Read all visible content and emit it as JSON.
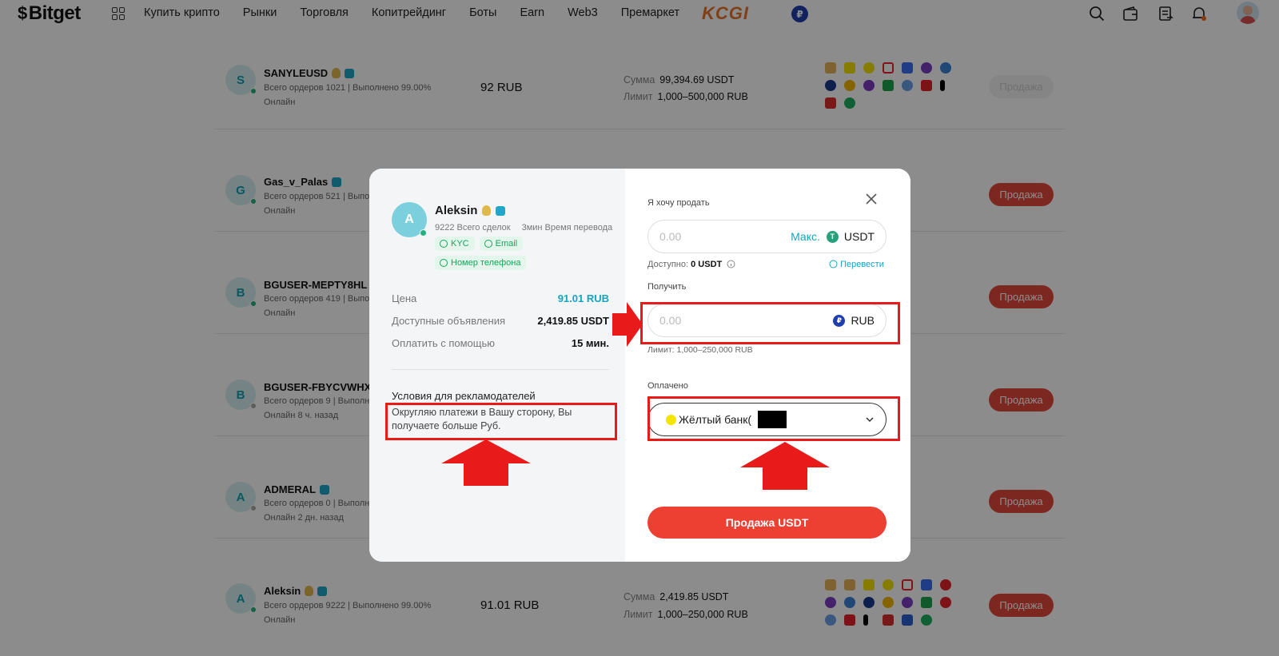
{
  "topbar": {
    "logo_text": "Bitget",
    "nav": [
      "Купить крипто",
      "Рынки",
      "Торговля",
      "Копитрейдинг",
      "Боты",
      "Earn",
      "Web3",
      "Премаркет"
    ],
    "promo_text": "KCGI",
    "currency_badge": "₽"
  },
  "list": {
    "rows": [
      {
        "initial": "S",
        "name": "SANYLEUSD",
        "sub": "Всего ордеров 1021 | Выполнено 99.00%",
        "status": "Онлайн",
        "price": "92 RUB",
        "amount_label": "Сумма",
        "amount": "99,394.69 USDT",
        "limit_label": "Лимит",
        "limit": "1,000–500,000 RUB",
        "button": "Продажа"
      },
      {
        "initial": "G",
        "name": "Gas_v_Palas",
        "sub": "Всего ордеров 521 | Выпол",
        "status": "Онлайн",
        "button": "Продажа"
      },
      {
        "initial": "B",
        "name": "BGUSER-MEPTY8HL",
        "sub": "Всего ордеров 419 | Выпол",
        "status": "Онлайн",
        "button": "Продажа"
      },
      {
        "initial": "B",
        "name": "BGUSER-FBYCVWHX",
        "sub": "Всего ордеров 9 | Выполне",
        "status": "Онлайн 8 ч. назад",
        "button": "Продажа"
      },
      {
        "initial": "A",
        "name": "ADMERAL",
        "sub": "Всего ордеров 0 | Выполнен",
        "status": "Онлайн 2 дн. назад",
        "button": "Продажа"
      },
      {
        "initial": "A",
        "name": "Aleksin",
        "sub": "Всего ордеров 9222 | Выполнено 99.00%",
        "status": "Онлайн",
        "price": "91.01 RUB",
        "amount_label": "Сумма",
        "amount": "2,419.85 USDT",
        "limit_label": "Лимит",
        "limit": "1,000–250,000 RUB",
        "button": "Продажа"
      }
    ]
  },
  "modal": {
    "merchant": {
      "initial": "A",
      "name": "Aleksin",
      "deals": "9222 Всего сделок",
      "transfer_time": "3мин Время перевода",
      "tags": [
        "KYC",
        "Email",
        "Номер телефона"
      ]
    },
    "price_label": "Цена",
    "price_value": "91.01 RUB",
    "available_label": "Доступные объявления",
    "available_value": "2,419.85 USDT",
    "pay_label": "Оплатить с помощью",
    "pay_value": "15 мин.",
    "terms_title": "Условия для рекламодателей",
    "terms_text": "Округляю платежи в Вашу сторону, Вы получаете больше Руб.",
    "sell_label": "Я хочу продать",
    "sell_placeholder": "0.00",
    "max_label": "Макс.",
    "sell_currency": "USDT",
    "available_text": "Доступно:",
    "available_amount": "0 USDT",
    "transfer_link": "Перевести",
    "receive_label": "Получить",
    "receive_placeholder": "0.00",
    "receive_currency": "RUB",
    "limit_text": "Лимит: 1,000–250,000 RUB",
    "paid_label": "Оплачено",
    "payment_method": "Жёлтый банк(",
    "payment_method_tail": ")",
    "submit_label": "Продажа USDT"
  },
  "colors": {
    "accent": "#16a3c0",
    "sell_button": "#ee3f33",
    "annotation_red": "#e81a1a"
  }
}
